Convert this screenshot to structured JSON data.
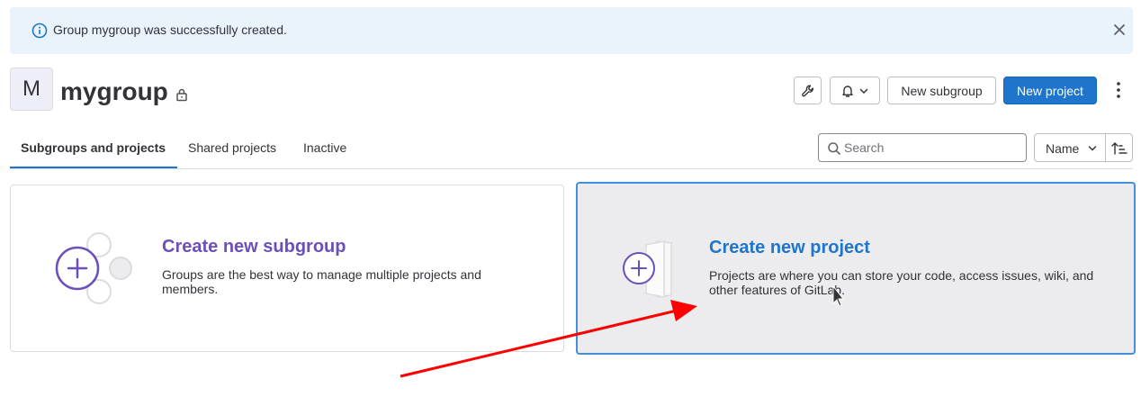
{
  "alert": {
    "message": "Group mygroup was successfully created."
  },
  "group": {
    "avatar_letter": "M",
    "name": "mygroup"
  },
  "header_actions": {
    "new_subgroup_label": "New subgroup",
    "new_project_label": "New project"
  },
  "tabs": [
    {
      "label": "Subgroups and projects",
      "active": true
    },
    {
      "label": "Shared projects",
      "active": false
    },
    {
      "label": "Inactive",
      "active": false
    }
  ],
  "search": {
    "placeholder": "Search",
    "value": ""
  },
  "sort": {
    "selected": "Name"
  },
  "cards": {
    "subgroup": {
      "title": "Create new subgroup",
      "description": "Groups are the best way to manage multiple projects and members."
    },
    "project": {
      "title": "Create new project",
      "description": "Projects are where you can store your code, access issues, wiki, and other features of GitLab."
    }
  },
  "icons": {
    "info": "info-icon",
    "close": "close-icon",
    "lock": "lock-icon",
    "settings": "wrench-icon",
    "notifications": "bell-icon",
    "more": "vertical-ellipsis-icon",
    "search": "search-icon",
    "sort_direction": "sort-ascending-icon"
  },
  "colors": {
    "primary": "#1f75cb",
    "subgroup_accent": "#6b4fbb",
    "alert_bg": "#e9f3fc",
    "annotation_arrow": "#ff0000"
  }
}
